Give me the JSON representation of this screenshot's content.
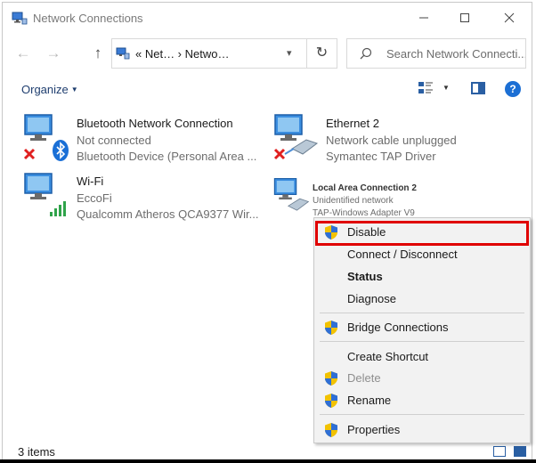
{
  "window": {
    "title": "Network Connections"
  },
  "nav": {
    "breadcrumb": "«  Net…  ›  Netwo…",
    "search_placeholder": "Search Network Connecti..."
  },
  "toolbar": {
    "organize_label": "Organize",
    "help_label": "?"
  },
  "connections": [
    {
      "name": "Bluetooth Network Connection",
      "status": "Not connected",
      "device": "Bluetooth Device (Personal Area ..."
    },
    {
      "name": "Ethernet 2",
      "status": "Network cable unplugged",
      "device": "Symantec TAP Driver"
    },
    {
      "name": "Wi-Fi",
      "status": "EccoFi",
      "device": "Qualcomm Atheros QCA9377 Wir..."
    },
    {
      "name": "Local Area Connection 2",
      "status": "Unidentified network",
      "device": "TAP-Windows Adapter V9"
    }
  ],
  "context_menu": {
    "items": [
      {
        "label": "Disable"
      },
      {
        "label": "Connect / Disconnect"
      },
      {
        "label": "Status"
      },
      {
        "label": "Diagnose"
      },
      {
        "label": "Bridge Connections"
      },
      {
        "label": "Create Shortcut"
      },
      {
        "label": "Delete"
      },
      {
        "label": "Rename"
      },
      {
        "label": "Properties"
      }
    ]
  },
  "status_bar": {
    "count": "3 items"
  },
  "colors": {
    "accent": "#1c6fd4",
    "highlight_border": "#e00000",
    "menu_background": "#f2f2f2"
  },
  "icons": {
    "title": "network-connections-icon",
    "shield": "uac-shield-icon",
    "bluetooth": "bluetooth-icon",
    "error": "red-x-icon",
    "signal": "wifi-signal-icon"
  }
}
